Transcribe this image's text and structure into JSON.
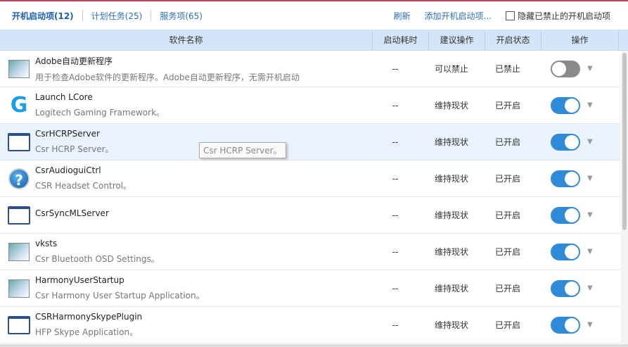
{
  "tabs": [
    {
      "label": "开机启动项(12)"
    },
    {
      "label": "计划任务(25)"
    },
    {
      "label": "服务项(65)"
    }
  ],
  "actions": {
    "refresh": "刷新",
    "add": "添加开机启动项...",
    "hide_disabled": "隐藏已禁止的开机启动项"
  },
  "columns": {
    "name": "软件名称",
    "time": "启动耗时",
    "suggest": "建议操作",
    "status": "开启状态",
    "op": "操作"
  },
  "tooltip": "Csr HCRP Server。",
  "rows": [
    {
      "icon": "app-icon",
      "title": "Adobe自动更新程序",
      "desc": "用于检查Adobe软件的更新程序。Adobe自动更新程序，无需开机启动",
      "time": "--",
      "suggest": "可以禁止",
      "status": "已禁止",
      "enabled": false
    },
    {
      "icon": "logitech-icon",
      "title": "Launch LCore",
      "desc": "Logitech Gaming Framework。",
      "time": "--",
      "suggest": "维持现状",
      "status": "已开启",
      "enabled": true
    },
    {
      "icon": "window-icon",
      "title": "CsrHCRPServer",
      "desc": "Csr HCRP Server。",
      "time": "--",
      "suggest": "维持现状",
      "status": "已开启",
      "enabled": true
    },
    {
      "icon": "help-icon",
      "title": "CsrAudioguiCtrl",
      "desc": "CSR Headset Control。",
      "time": "--",
      "suggest": "维持现状",
      "status": "已开启",
      "enabled": true
    },
    {
      "icon": "window-icon",
      "title": "CsrSyncMLServer",
      "desc": "",
      "time": "--",
      "suggest": "维持现状",
      "status": "已开启",
      "enabled": true
    },
    {
      "icon": "app-icon",
      "title": "vksts",
      "desc": "Csr Bluetooth OSD Settings。",
      "time": "--",
      "suggest": "维持现状",
      "status": "已开启",
      "enabled": true
    },
    {
      "icon": "app-icon",
      "title": "HarmonyUserStartup",
      "desc": "Csr Harmony User Startup Application。",
      "time": "--",
      "suggest": "维持现状",
      "status": "已开启",
      "enabled": true
    },
    {
      "icon": "window-icon",
      "title": "CSRHarmonySkypePlugin",
      "desc": "HFP Skype Application。",
      "time": "--",
      "suggest": "维持现状",
      "status": "已开启",
      "enabled": true
    }
  ]
}
